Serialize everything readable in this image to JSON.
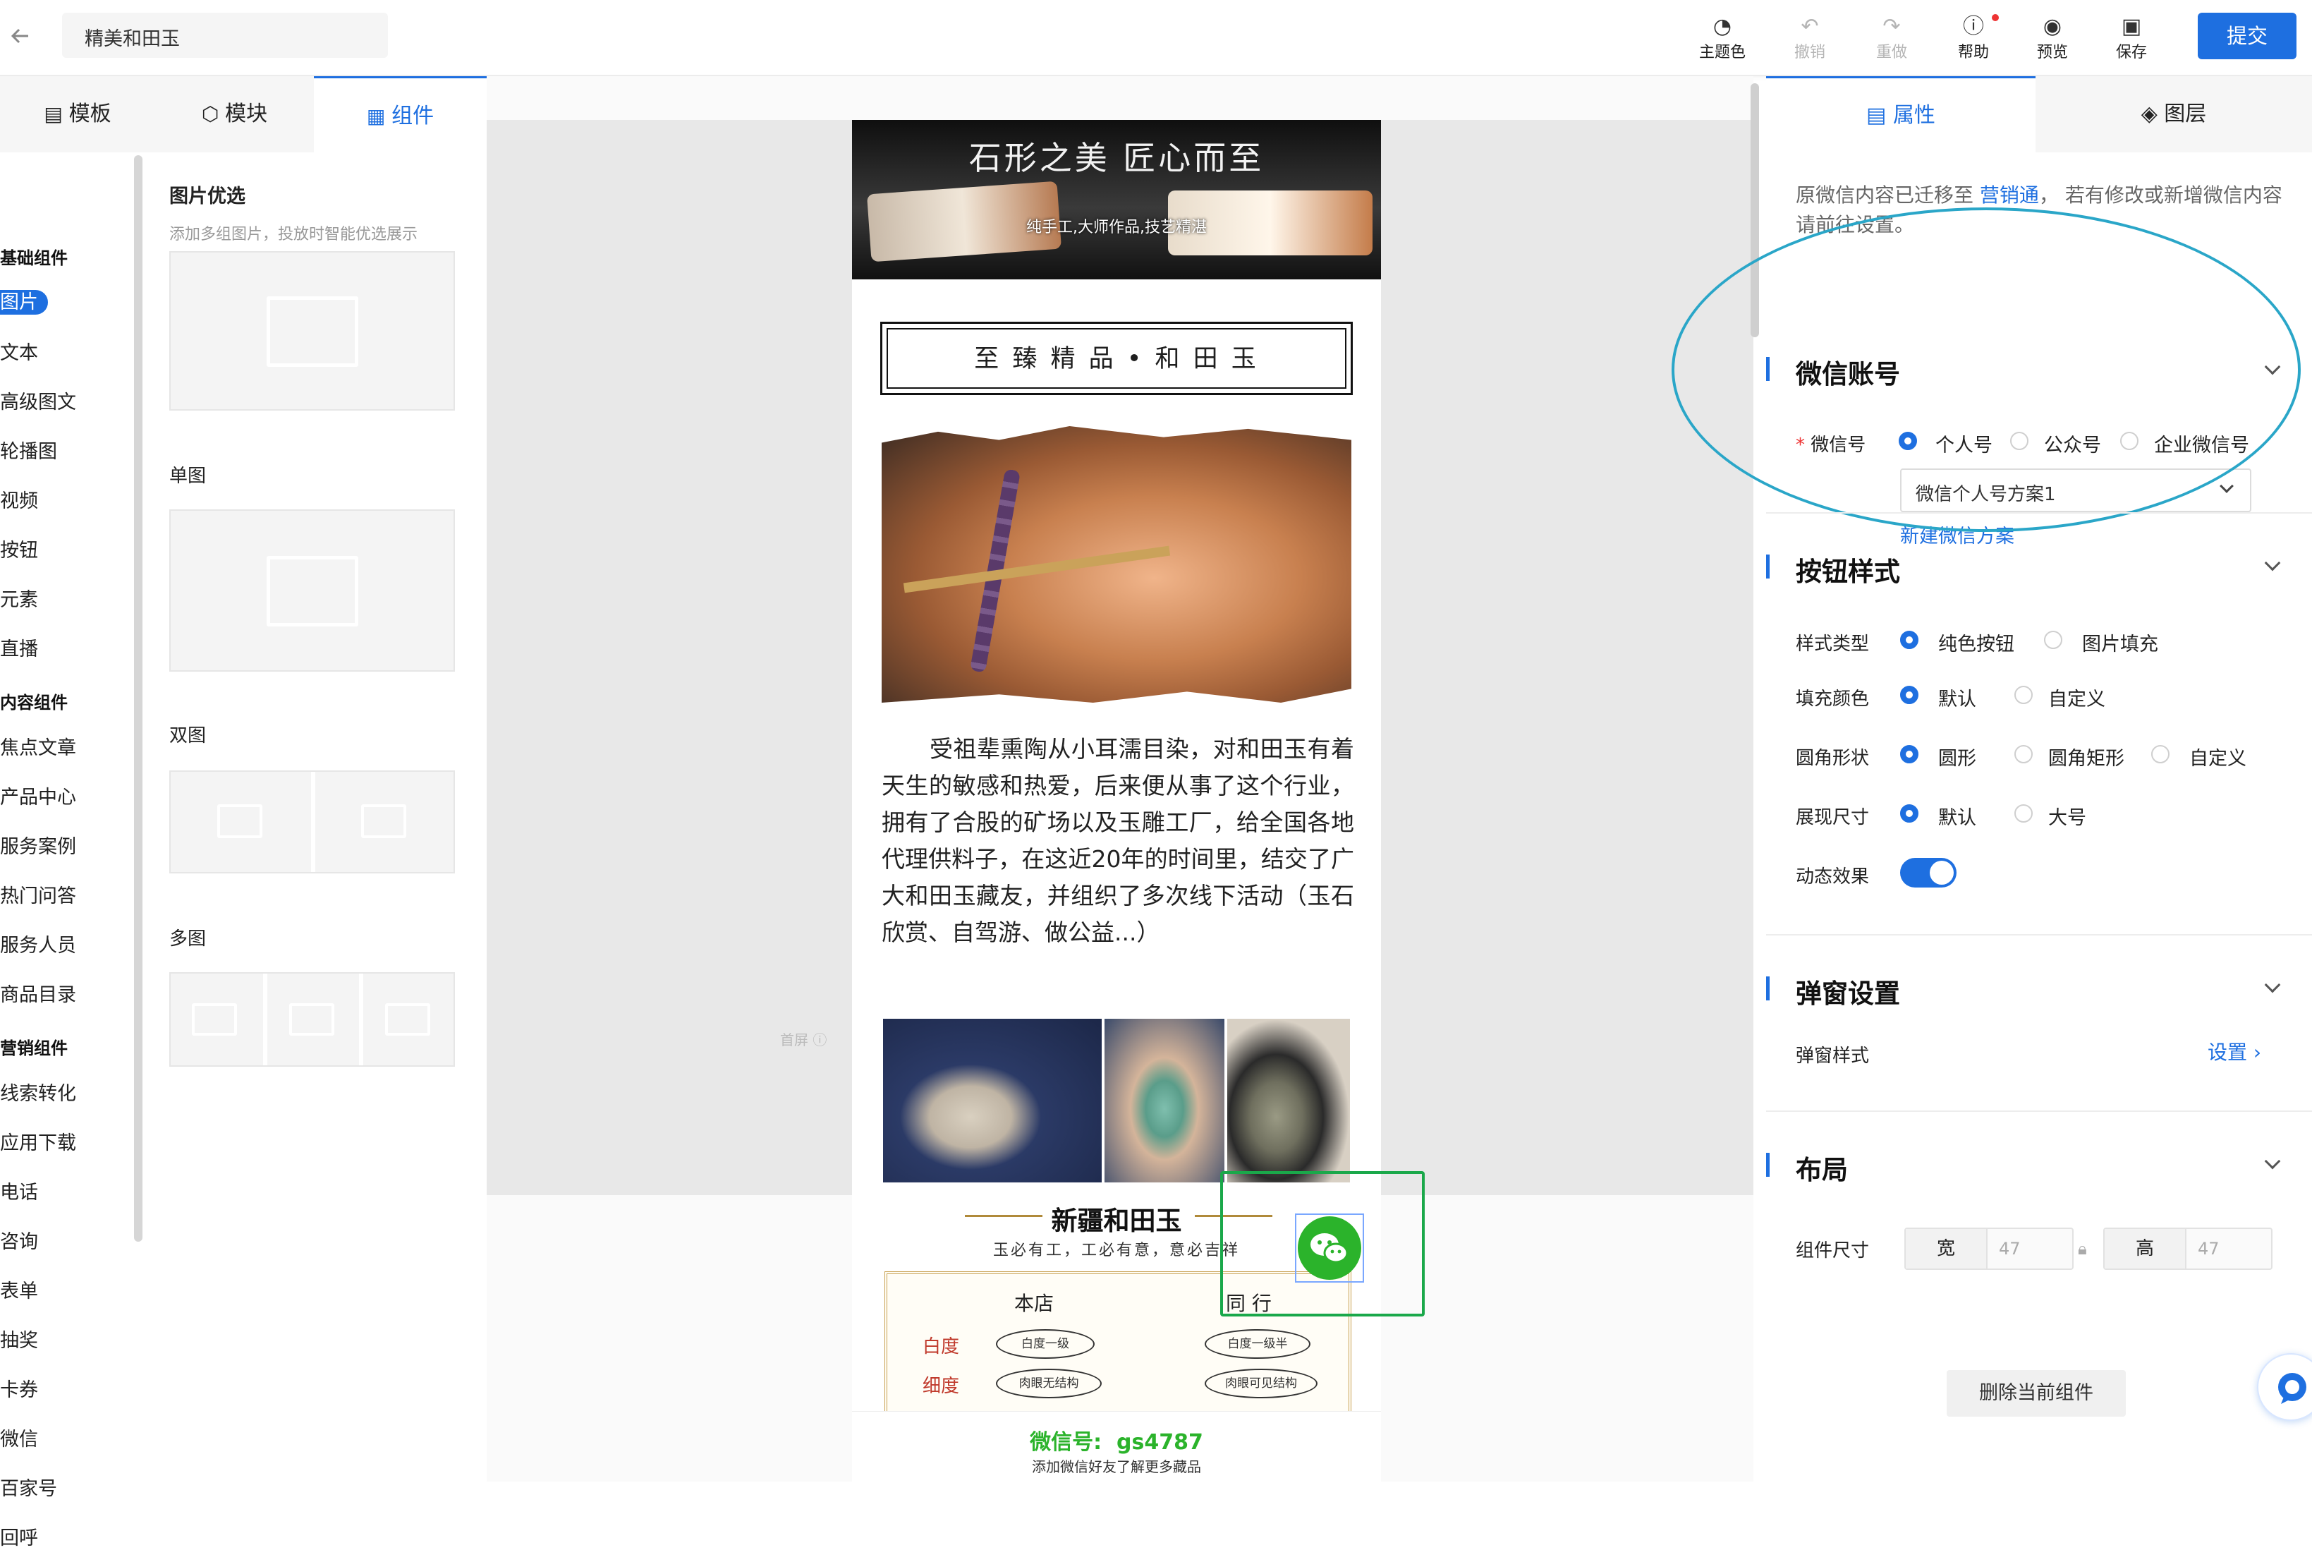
{
  "header": {
    "back_icon": "arrow-left-icon",
    "title": "精美和田玉",
    "tools": [
      {
        "label": "主题色",
        "icon": "palette-icon",
        "enabled": true
      },
      {
        "label": "撤销",
        "icon": "undo-icon",
        "enabled": false
      },
      {
        "label": "重做",
        "icon": "redo-icon",
        "enabled": false
      },
      {
        "label": "帮助",
        "icon": "help-circle-icon",
        "enabled": true
      },
      {
        "label": "预览",
        "icon": "eye-icon",
        "enabled": true
      },
      {
        "label": "保存",
        "icon": "save-icon",
        "enabled": true
      }
    ],
    "submit_label": "提交"
  },
  "left_tabs": [
    {
      "label": "模板",
      "icon": "template-icon"
    },
    {
      "label": "模块",
      "icon": "module-icon"
    },
    {
      "label": "组件",
      "icon": "grid-icon",
      "active": true
    }
  ],
  "categories": [
    {
      "title": "基础组件",
      "items": [
        "图片",
        "文本",
        "高级图文",
        "轮播图",
        "视频",
        "按钮",
        "元素",
        "直播"
      ]
    },
    {
      "title": "内容组件",
      "items": [
        "焦点文章",
        "产品中心",
        "服务案例",
        "热门问答",
        "服务人员",
        "商品目录"
      ]
    },
    {
      "title": "营销组件",
      "items": [
        "线索转化",
        "应用下载",
        "电话",
        "咨询",
        "表单",
        "抽奖",
        "卡券",
        "微信",
        "百家号",
        "回呼"
      ]
    }
  ],
  "selected_item": "图片",
  "image_components": {
    "heading": "图片优选",
    "hint": "添加多组图片，投放时智能优选展示",
    "variants": [
      "单图",
      "双图",
      "多图"
    ]
  },
  "preview": {
    "banner_title": "石形之美 匠心而至",
    "banner_sub": "纯手工,大师作品,技艺精湛",
    "frame_title": "至 臻 精 品 • 和 田 玉",
    "paragraph": "受祖辈熏陶从小耳濡目染，对和田玉有着天生的敏感和热爱，后来便从事了这个行业，拥有了合股的矿场以及玉雕工厂，给全国各地代理供料子，在这近20年的时间里，结交了广大和田玉藏友，并组织了多次线下活动（玉石欣赏、自驾游、做公益...）",
    "brand_title": "新疆和田玉",
    "brand_motto": "玉必有工，工必有意，意必吉祥",
    "chart_left": "本店",
    "chart_right": "同 行",
    "row1_label": "白度",
    "row2_label": "细度",
    "oval1": "白度一级",
    "oval2": "肉眼无结构",
    "oval3": "白度一级半",
    "oval4": "肉眼可见结构",
    "first_screen": "首屏",
    "wechat_bar": "微信号:  gs4787",
    "wechat_bar_sub": "添加微信好友了解更多藏品"
  },
  "right_tabs": [
    {
      "label": "属性",
      "icon": "list-icon",
      "active": true
    },
    {
      "label": "图层",
      "icon": "layers-icon"
    }
  ],
  "notice": {
    "before": "原微信内容已迁移至 ",
    "link": "营销通",
    "after": "， 若有修改或新增微信内容请前往设置。"
  },
  "wechat": {
    "title": "微信账号",
    "field_label": "微信号",
    "options": [
      "个人号",
      "公众号",
      "企业微信号"
    ],
    "selected": "个人号",
    "select_value": "微信个人号方案1",
    "new_link": "新建微信方案"
  },
  "button_style": {
    "title": "按钮样式",
    "rows": [
      {
        "label": "样式类型",
        "options": [
          "纯色按钮",
          "图片填充"
        ],
        "selected": 0
      },
      {
        "label": "填充颜色",
        "options": [
          "默认",
          "自定义"
        ],
        "selected": 0
      },
      {
        "label": "圆角形状",
        "options": [
          "圆形",
          "圆角矩形",
          "自定义"
        ],
        "selected": 0
      },
      {
        "label": "展现尺寸",
        "options": [
          "默认",
          "大号"
        ],
        "selected": 0
      }
    ],
    "effect_label": "动态效果",
    "effect_on": true
  },
  "popup": {
    "title": "弹窗设置",
    "label": "弹窗样式",
    "action": "设置"
  },
  "layout": {
    "title": "布局",
    "label": "组件尺寸",
    "width_label": "宽",
    "width_value": "47",
    "height_label": "高",
    "height_value": "47"
  },
  "delete_label": "删除当前组件",
  "colors": {
    "primary": "#1e6fe0",
    "wechat_green": "#2bb32b",
    "highlight_green": "#1aa84a",
    "annotation_circle": "#2aa6c8"
  }
}
